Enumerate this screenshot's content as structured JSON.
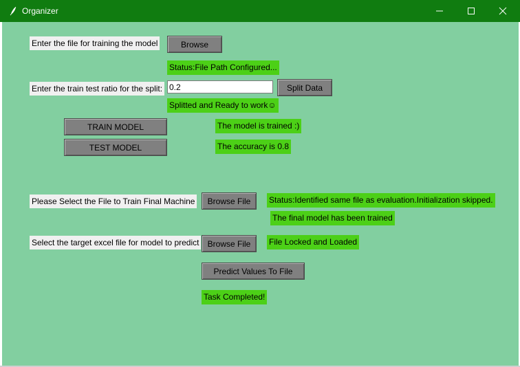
{
  "window": {
    "title": "Organizer",
    "controls": [
      "minimize-icon",
      "maximize-icon",
      "close-icon"
    ],
    "colors": {
      "titlebar": "#107c10",
      "background": "#82cfa0",
      "status": "#4cd017",
      "button": "#808080"
    }
  },
  "training_file": {
    "label": "Enter the file for training the model",
    "browse_label": "Browse",
    "status": "Status:File Path Configured..."
  },
  "split": {
    "label": "Enter the train test ratio for the split:",
    "ratio_value": "0.2",
    "button_label": "Split Data",
    "status": "Splitted and Ready to work☺"
  },
  "model": {
    "train_label": "TRAIN MODEL",
    "train_status": "The model is trained :)",
    "test_label": "TEST MODEL",
    "test_status": "The accuracy is 0.8"
  },
  "final_machine": {
    "label": "Please Select the File to Train Final Machine",
    "browse_label": "Browse File",
    "status": "Status:Identified same file as evaluation.Initialization skipped.",
    "trained_status": "The final model has been trained"
  },
  "predict": {
    "label": "Select the target excel file for model to predict",
    "browse_label": "Browse File",
    "status": "File Locked and Loaded",
    "button_label": "Predict Values To File",
    "completed_status": "Task Completed!"
  }
}
